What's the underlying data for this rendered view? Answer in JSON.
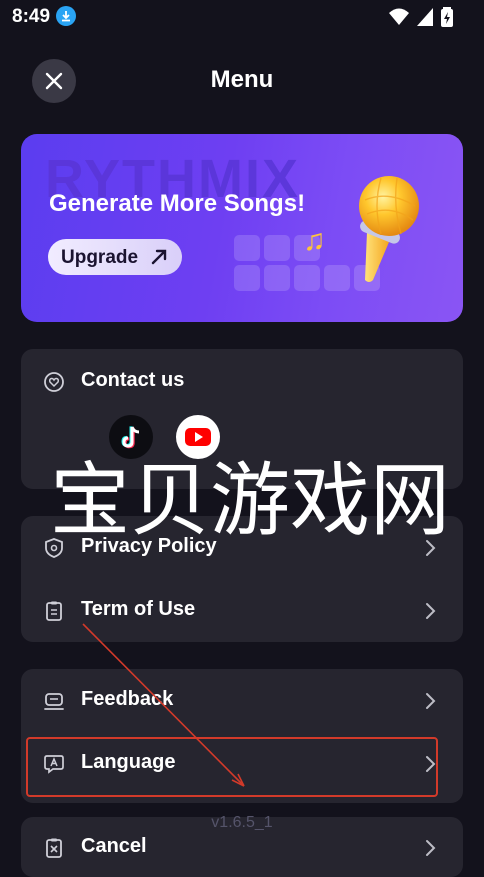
{
  "status_bar": {
    "time": "8:49",
    "icons": [
      "download-icon",
      "wifi-icon",
      "signal-icon",
      "battery-icon"
    ]
  },
  "header": {
    "title": "Menu"
  },
  "banner": {
    "background_word": "RYTHMIX",
    "title": "Generate More Songs!",
    "button_label": "Upgrade"
  },
  "contact": {
    "label": "Contact us",
    "socials": [
      "tiktok-icon",
      "youtube-icon"
    ]
  },
  "legal": {
    "items": [
      {
        "label": "Privacy Policy",
        "icon": "shield-icon"
      },
      {
        "label": "Term of Use",
        "icon": "clipboard-icon"
      }
    ]
  },
  "support": {
    "items": [
      {
        "label": "Feedback",
        "icon": "feedback-icon"
      },
      {
        "label": "Language",
        "icon": "language-icon"
      }
    ]
  },
  "account": {
    "items": [
      {
        "label": "Cancel",
        "icon": "cancel-doc-icon"
      }
    ]
  },
  "version": "v1.6.5_1",
  "watermark": "宝贝游戏网",
  "colors": {
    "background": "#13121c",
    "card": "#26252f",
    "banner_start": "#5b3df0",
    "banner_end": "#8a55f4",
    "annotation_red": "#d23a2a"
  }
}
